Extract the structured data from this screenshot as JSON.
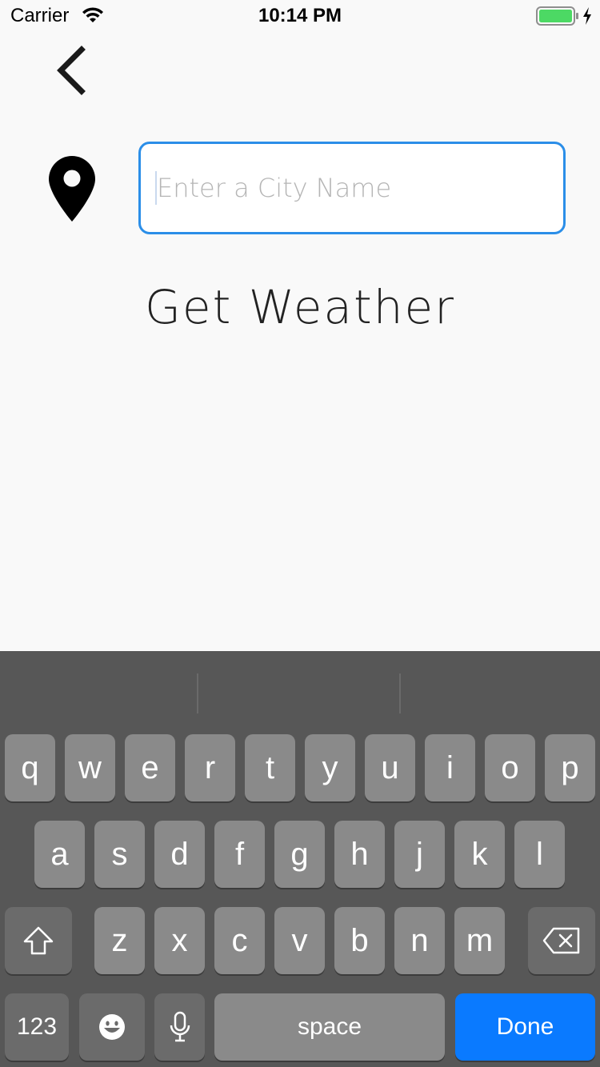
{
  "status_bar": {
    "carrier": "Carrier",
    "time": "10:14 PM",
    "battery_color": "#4cd964"
  },
  "nav": {
    "back_icon": "chevron-left-icon"
  },
  "location": {
    "icon": "map-pin-icon"
  },
  "search": {
    "placeholder": "Enter a City Name",
    "value": "",
    "border_color": "#2b8ee8"
  },
  "action": {
    "label": "Get Weather"
  },
  "keyboard": {
    "row1": [
      "q",
      "w",
      "e",
      "r",
      "t",
      "y",
      "u",
      "i",
      "o",
      "p"
    ],
    "row2": [
      "a",
      "s",
      "d",
      "f",
      "g",
      "h",
      "j",
      "k",
      "l"
    ],
    "row3": [
      "z",
      "x",
      "c",
      "v",
      "b",
      "n",
      "m"
    ],
    "shift_icon": "shift-icon",
    "delete_icon": "backspace-icon",
    "numbers_label": "123",
    "emoji_icon": "emoji-icon",
    "mic_icon": "microphone-icon",
    "space_label": "space",
    "done_label": "Done",
    "done_color": "#0a7aff"
  }
}
